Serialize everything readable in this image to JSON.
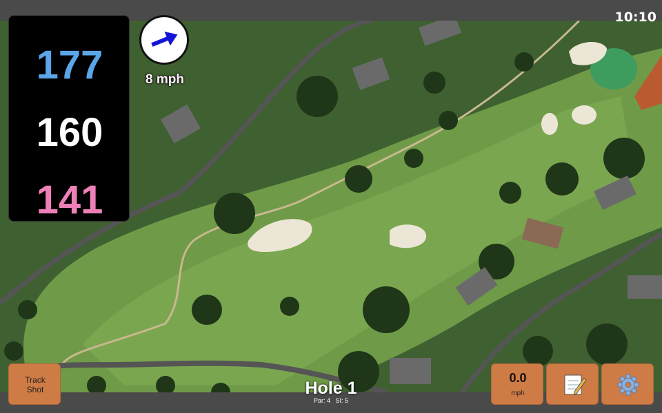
{
  "status": {
    "time": "10:10"
  },
  "yardages": {
    "back": "177",
    "middle": "160",
    "front": "141"
  },
  "wind": {
    "speed": "8 mph",
    "icon": "arrow-right-icon",
    "arrow_color": "#1414d8"
  },
  "hole": {
    "title": "Hole 1",
    "par_label": "Par: 4",
    "si_label": "SI: 5"
  },
  "buttons": {
    "track_line1": "Track",
    "track_line2": "Shot",
    "speed_value": "0.0",
    "speed_unit": "mph",
    "notes_icon": "notepad-icon",
    "settings_icon": "gear-icon"
  },
  "colors": {
    "back": "#5aa6e8",
    "middle": "#ffffff",
    "front": "#ee80b8",
    "button": "#cf7b46"
  }
}
